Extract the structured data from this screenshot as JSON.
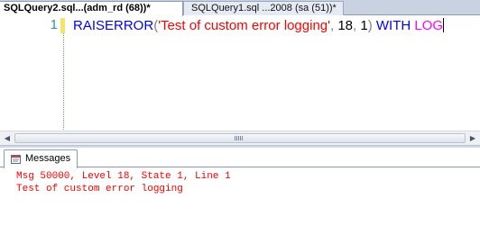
{
  "document_tabs": [
    {
      "label": "SQLQuery2.sql...(adm_rd (68))*",
      "active": true
    },
    {
      "label": "SQLQuery1.sql ...2008 (sa (51))*",
      "active": false
    }
  ],
  "editor": {
    "line_number": "1",
    "code_tokens": {
      "raiserror": "RAISERROR",
      "open_paren": "(",
      "message": "'Test of custom error logging'",
      "comma1": ",",
      "severity": " 18",
      "comma2": ",",
      "state": " 1",
      "close_paren": ")",
      "with": " WITH ",
      "log": "LOG"
    }
  },
  "results": {
    "tab_label": "Messages",
    "tab_icon": "message-icon",
    "lines": [
      "Msg 50000, Level 18, State 1, Line 1",
      "Test of custom error logging"
    ]
  },
  "colors": {
    "keyword": "#0000ff",
    "string": "#ff0000",
    "operator": "#808080",
    "function_keyword": "#ff00ff",
    "error_text": "#ff0000",
    "line_number": "#2b91af"
  }
}
